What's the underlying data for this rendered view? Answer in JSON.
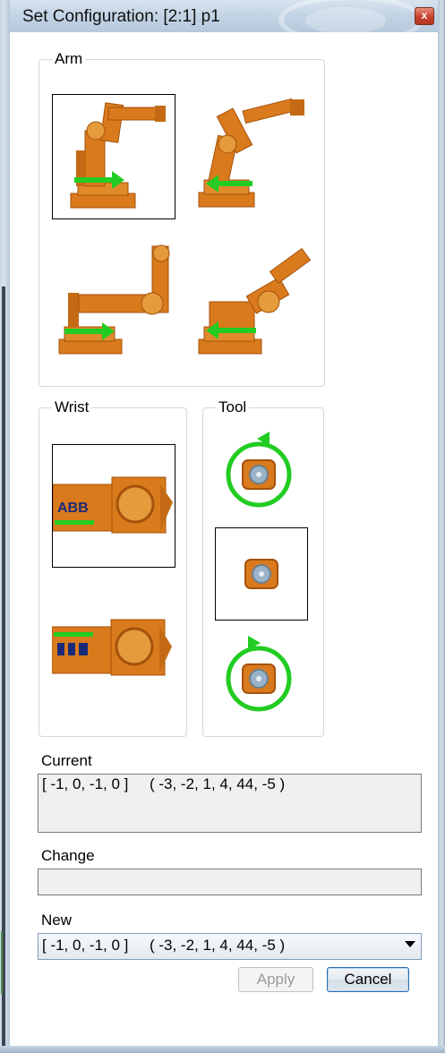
{
  "window": {
    "title": "Set Configuration: [2:1] p1",
    "close_glyph": "x"
  },
  "groups": {
    "arm": "Arm",
    "wrist": "Wrist",
    "tool": "Tool"
  },
  "current": {
    "label": "Current",
    "value": "[ -1, 0, -1, 0 ]     ( -3, -2, 1, 4, 44, -5 )"
  },
  "change": {
    "label": "Change",
    "value": ""
  },
  "new": {
    "label": "New",
    "value": "[ -1, 0, -1, 0 ]     ( -3, -2, 1, 4, 44, -5 )"
  },
  "buttons": {
    "apply": "Apply",
    "cancel": "Cancel"
  },
  "wrist_logo": "ABB",
  "colors": {
    "robot": "#d97a1c",
    "robot_dark": "#a5520c",
    "arrow": "#22cc22",
    "selection_border": "#000000",
    "frame": "#c2d3e4"
  }
}
